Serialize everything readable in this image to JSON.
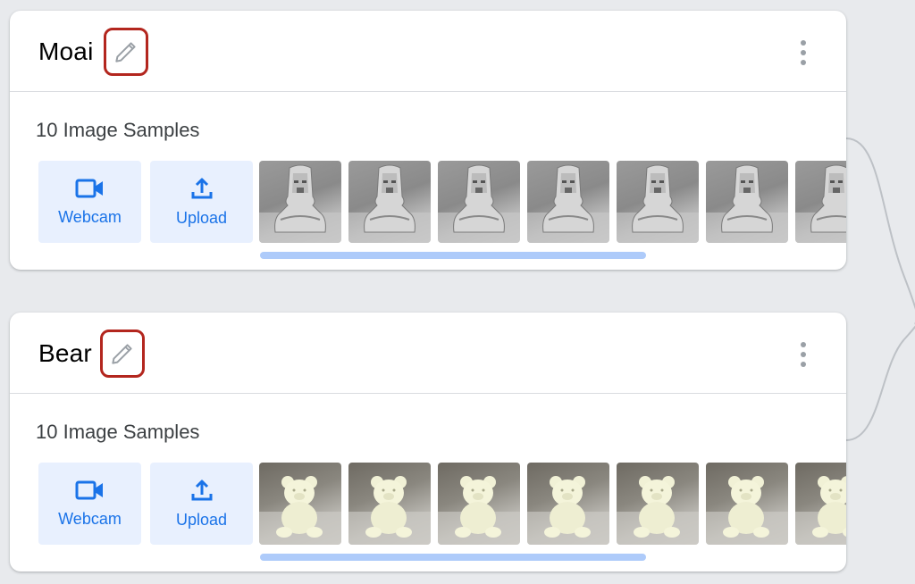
{
  "classes": [
    {
      "name": "Moai",
      "samples_label": "10 Image Samples",
      "webcam_label": "Webcam",
      "upload_label": "Upload",
      "thumb_count_visible": 7,
      "thumb_subject": "moai-statue"
    },
    {
      "name": "Bear",
      "samples_label": "10 Image Samples",
      "webcam_label": "Webcam",
      "upload_label": "Upload",
      "thumb_count_visible": 7,
      "thumb_subject": "bear-figurine"
    }
  ],
  "icons": {
    "edit": "pencil-icon",
    "menu": "more-vert-icon",
    "webcam": "videocam-icon",
    "upload": "upload-icon"
  },
  "colors": {
    "accent": "#1a73e8",
    "button_bg": "#e8f0fe",
    "edit_highlight": "#b3261e",
    "scrollbar": "#aecbfa",
    "background": "#e8eaed"
  }
}
